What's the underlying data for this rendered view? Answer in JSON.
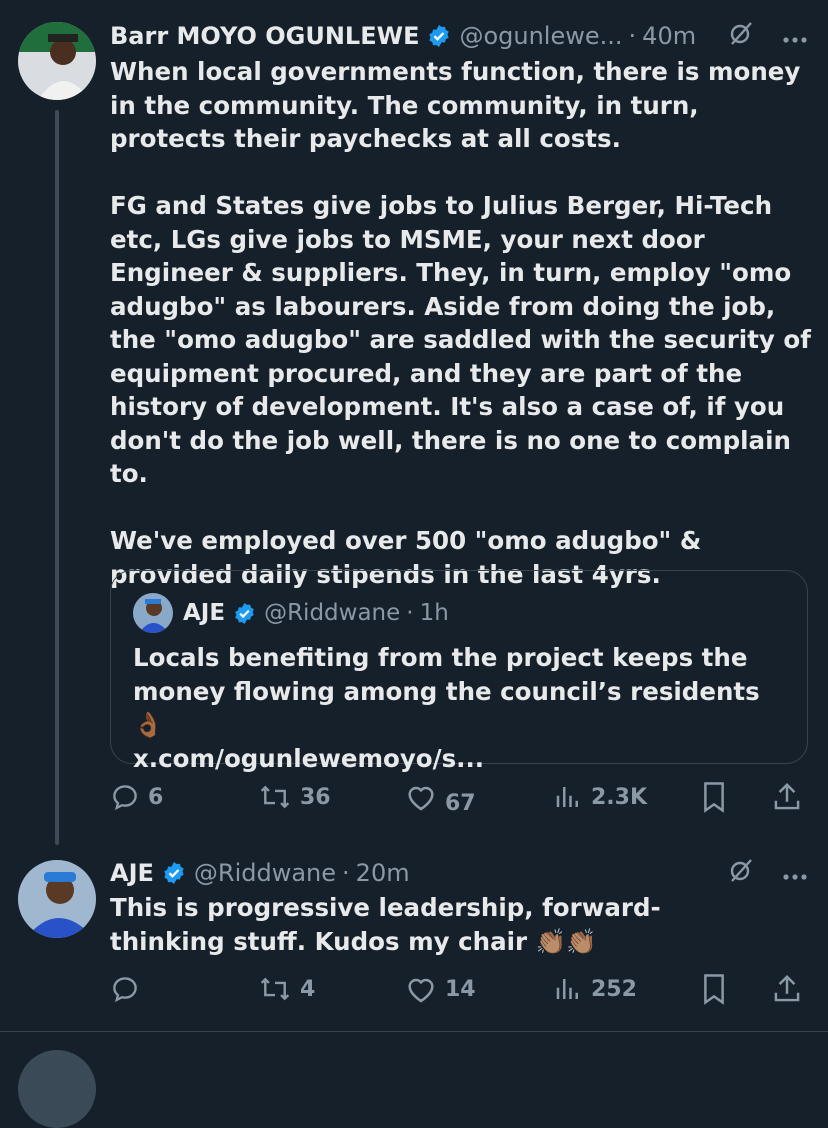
{
  "tweet1": {
    "name": "Barr MOYO OGUNLEWE",
    "handle": "@ogunlewe...",
    "sep": "·",
    "time": "40m",
    "text": "When local governments function, there is money in the community. The community, in turn, protects their paychecks at all costs.\n\nFG and States give jobs to Julius Berger, Hi-Tech etc, LGs give jobs to MSME, your next door Engineer & suppliers. They, in turn, employ \"omo adugbo\" as labourers. Aside from doing the job, the \"omo adugbo\" are saddled with the security of equipment procured, and they are part of the history of development. It's also a case of, if you don't do the job well, there is no one to complain to.\n\nWe've employed over 500 \"omo adugbo\" & provided daily stipends in the last 4yrs.",
    "quote": {
      "name": "AJE",
      "handle": "@Riddwane",
      "sep": "·",
      "time": "1h",
      "text": "Locals benefiting from the project keeps the money flowing among the council’s residents 👌🏾\nx.com/ogunlewemoyo/s..."
    },
    "replies": "6",
    "reposts": "36",
    "likes": "67",
    "views": "2.3K"
  },
  "tweet2": {
    "name": "AJE",
    "handle": "@Riddwane",
    "sep": "·",
    "time": "20m",
    "text": "This is progressive leadership, forward-thinking stuff. Kudos my chair 👏🏽👏🏽",
    "reposts": "4",
    "likes": "14",
    "views": "252"
  },
  "colors": {
    "background": "#15202b",
    "text": "#e7e9ea",
    "muted": "#8b98a5",
    "verified": "#1d9bf0",
    "border": "#38444d"
  }
}
